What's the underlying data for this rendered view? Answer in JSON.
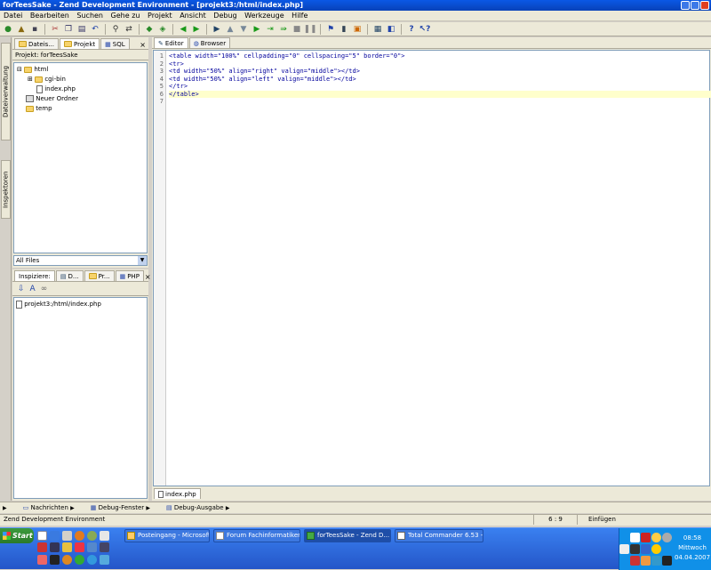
{
  "window": {
    "title": "forTeesSake - Zend Development Environment - [projekt3:/html/index.php]"
  },
  "menu": [
    "Datei",
    "Bearbeiten",
    "Suchen",
    "Gehe zu",
    "Projekt",
    "Ansicht",
    "Debug",
    "Werkzeuge",
    "Hilfe"
  ],
  "side_tabs": {
    "top": "Dateiverwaltung",
    "bottom": "Inspektoren"
  },
  "file_panel": {
    "tabs": [
      "Dateis...",
      "Projekt",
      "SQL"
    ],
    "project_label": "Projekt: forTeesSake",
    "tree": [
      "html",
      "cgi-bin",
      "index.php",
      "Neuer Ordner",
      "temp"
    ],
    "filter": "All Files"
  },
  "inspector_panel": {
    "tabs": [
      "Inspiziere:",
      "D...",
      "Pr...",
      "PHP"
    ],
    "item": "projekt3:/html/index.php"
  },
  "editor": {
    "tabs": [
      "Editor",
      "Browser"
    ],
    "lines": [
      "<table width=\"100%\" cellpadding=\"0\" cellspacing=\"5\" border=\"0\">",
      "<tr>",
      "<td width=\"50%\" align=\"right\" valign=\"middle\"></td>",
      "<td width=\"50%\" align=\"left\" valign=\"middle\"></td>",
      "</tr>",
      "</table>",
      ""
    ],
    "line_numbers": [
      "1",
      "2",
      "3",
      "4",
      "5",
      "6",
      "7"
    ],
    "file_tab": "index.php"
  },
  "bottom_tabs": [
    "Nachrichten",
    "Debug-Fenster",
    "Debug-Ausgabe"
  ],
  "status": {
    "text": "Zend Development Environment",
    "position": "6 : 9",
    "mode": "Einfügen"
  },
  "taskbar": {
    "start": "Start",
    "tasks": [
      "Posteingang - Microsoft ...",
      "Forum Fachinformatiker....",
      "forTeesSake - Zend D...",
      "Total Commander 6.53 - ..."
    ],
    "clock": {
      "time": "08:58",
      "day": "Mittwoch",
      "date": "04.04.2007"
    }
  }
}
